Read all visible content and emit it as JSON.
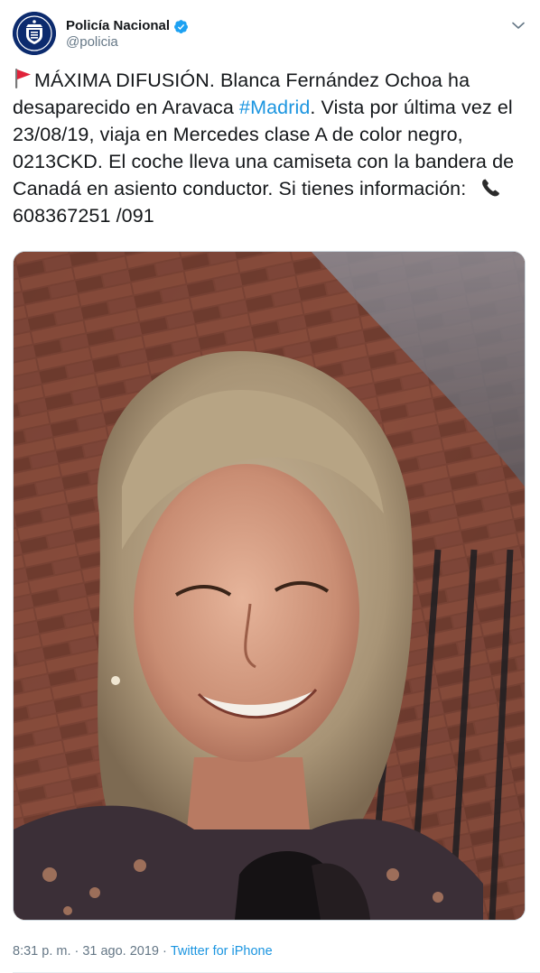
{
  "author": {
    "name": "Policía Nacional",
    "handle": "@policia",
    "verified": true,
    "avatar_icon": "police-badge-icon"
  },
  "tweet": {
    "flag_icon": "red-flag-icon",
    "text_1": "MÁXIMA DIFUSIÓN. Blanca Fernández Ochoa ha desaparecido en Aravaca ",
    "hashtag": "#Madrid",
    "text_2": ". Vista por última vez el 23/08/19, viaja en Mercedes clase A de color negro, 0213CKD. El coche lleva una camiseta con la bandera de Canadá en asiento conductor. Si tienes información:",
    "phone_icon": "telephone-receiver-icon",
    "phone": "608367251 /091"
  },
  "meta": {
    "time": "8:31 p. m.",
    "separator": "·",
    "date": "31 ago. 2019",
    "source": "Twitter for iPhone"
  },
  "colors": {
    "link": "#1b95e0",
    "secondary_text": "#657786",
    "verified": "#1da1f2"
  }
}
